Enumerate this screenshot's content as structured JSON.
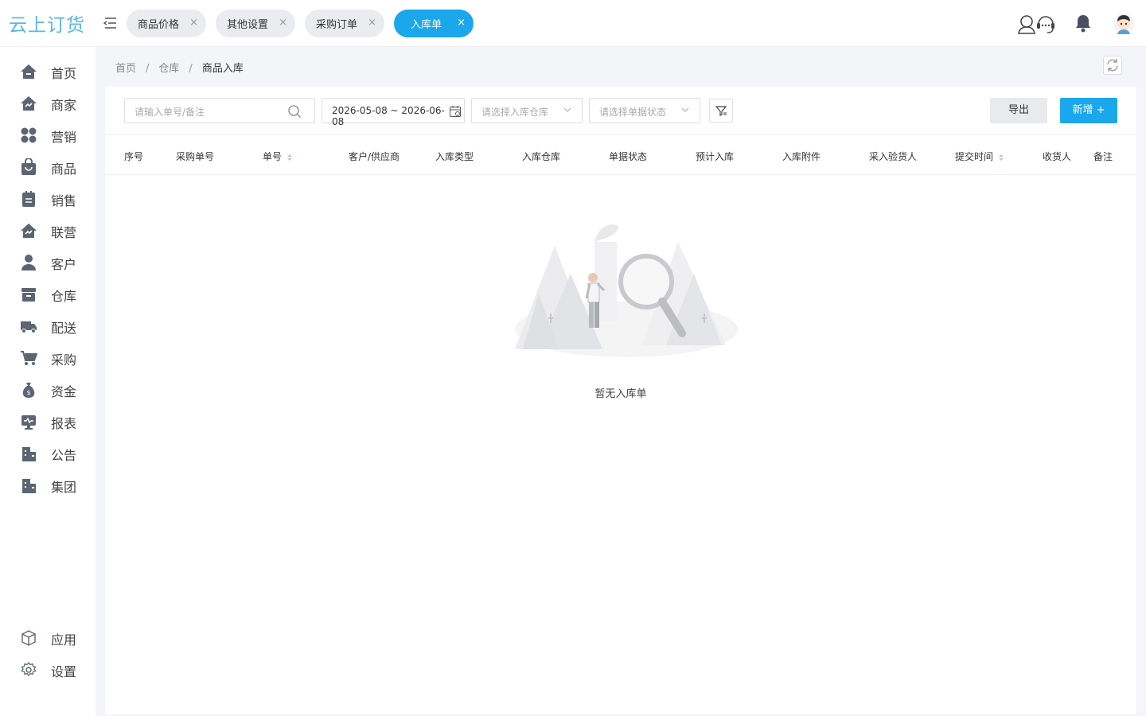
{
  "app": {
    "logo": "云上订货"
  },
  "tabs": [
    {
      "label": "商品价格",
      "close": "×"
    },
    {
      "label": "其他设置",
      "close": "×"
    },
    {
      "label": "采购订单",
      "close": "×"
    },
    {
      "label": "入库单",
      "close": "×",
      "active": true
    }
  ],
  "sidebar": {
    "items": [
      {
        "label": "首页",
        "icon": "home-icon"
      },
      {
        "label": "商家",
        "icon": "merchant-icon"
      },
      {
        "label": "营销",
        "icon": "marketing-icon"
      },
      {
        "label": "商品",
        "icon": "goods-icon"
      },
      {
        "label": "销售",
        "icon": "sales-icon"
      },
      {
        "label": "联营",
        "icon": "joint-icon"
      },
      {
        "label": "客户",
        "icon": "customer-icon"
      },
      {
        "label": "仓库",
        "icon": "warehouse-icon"
      },
      {
        "label": "配送",
        "icon": "truck-icon"
      },
      {
        "label": "采购",
        "icon": "cart-icon"
      },
      {
        "label": "资金",
        "icon": "money-bag-icon"
      },
      {
        "label": "报表",
        "icon": "report-icon"
      },
      {
        "label": "公告",
        "icon": "notice-icon"
      },
      {
        "label": "集团",
        "icon": "group-icon"
      }
    ],
    "bottom": [
      {
        "label": "应用",
        "icon": "cube-icon"
      },
      {
        "label": "设置",
        "icon": "gear-icon"
      }
    ]
  },
  "breadcrumb": {
    "items": [
      "首页",
      "仓库"
    ],
    "current": "商品入库",
    "sep": "/"
  },
  "filters": {
    "search_placeholder": "请输入单号/备注",
    "date_range": "2026-05-08 ~ 2026-06-08",
    "warehouse_placeholder": "请选择入库仓库",
    "status_placeholder": "请选择单据状态"
  },
  "actions": {
    "export": "导出",
    "new": "新增 +"
  },
  "table": {
    "headers": [
      "序号",
      "采购单号",
      "单号",
      "客户/供应商",
      "入库类型",
      "入库仓库",
      "单据状态",
      "预计入库",
      "入库附件",
      "采入验货人",
      "提交时间",
      "收货人",
      "备注"
    ]
  },
  "empty": {
    "text": "暂无入库单"
  },
  "colors": {
    "accent": "#1aa7ec",
    "logo": "#5ab6e6"
  }
}
